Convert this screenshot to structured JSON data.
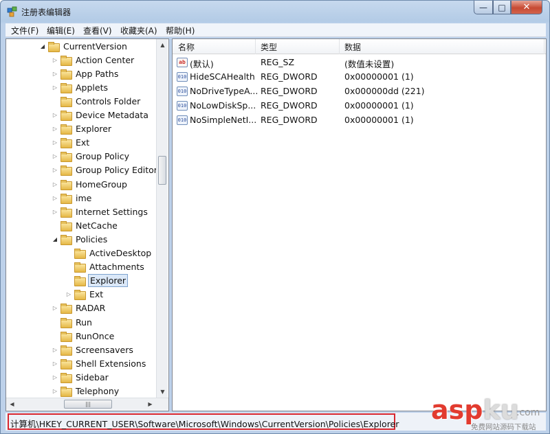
{
  "window": {
    "title": "注册表编辑器",
    "controls": {
      "minimize": "—",
      "maximize": "□",
      "close": "✕"
    }
  },
  "menubar": {
    "items": [
      {
        "label": "文件(F)"
      },
      {
        "label": "编辑(E)"
      },
      {
        "label": "查看(V)"
      },
      {
        "label": "收藏夹(A)"
      },
      {
        "label": "帮助(H)"
      }
    ]
  },
  "tree": {
    "items": [
      {
        "label": "CurrentVersion",
        "expander": "◢",
        "depth": 0
      },
      {
        "label": "Action Center",
        "expander": "▷",
        "depth": 1
      },
      {
        "label": "App Paths",
        "expander": "▷",
        "depth": 1
      },
      {
        "label": "Applets",
        "expander": "▷",
        "depth": 1
      },
      {
        "label": "Controls Folder",
        "expander": "",
        "depth": 1
      },
      {
        "label": "Device Metadata",
        "expander": "▷",
        "depth": 1
      },
      {
        "label": "Explorer",
        "expander": "▷",
        "depth": 1
      },
      {
        "label": "Ext",
        "expander": "▷",
        "depth": 1
      },
      {
        "label": "Group Policy",
        "expander": "▷",
        "depth": 1
      },
      {
        "label": "Group Policy Editor",
        "expander": "▷",
        "depth": 1
      },
      {
        "label": "HomeGroup",
        "expander": "▷",
        "depth": 1
      },
      {
        "label": "ime",
        "expander": "▷",
        "depth": 1
      },
      {
        "label": "Internet Settings",
        "expander": "▷",
        "depth": 1
      },
      {
        "label": "NetCache",
        "expander": "",
        "depth": 1
      },
      {
        "label": "Policies",
        "expander": "◢",
        "depth": 1
      },
      {
        "label": "ActiveDesktop",
        "expander": "",
        "depth": 2
      },
      {
        "label": "Attachments",
        "expander": "",
        "depth": 2
      },
      {
        "label": "Explorer",
        "expander": "",
        "depth": 2,
        "selected": true
      },
      {
        "label": "Ext",
        "expander": "▷",
        "depth": 2
      },
      {
        "label": "RADAR",
        "expander": "▷",
        "depth": 1
      },
      {
        "label": "Run",
        "expander": "",
        "depth": 1
      },
      {
        "label": "RunOnce",
        "expander": "",
        "depth": 1
      },
      {
        "label": "Screensavers",
        "expander": "▷",
        "depth": 1
      },
      {
        "label": "Shell Extensions",
        "expander": "▷",
        "depth": 1
      },
      {
        "label": "Sidebar",
        "expander": "▷",
        "depth": 1
      },
      {
        "label": "Telephony",
        "expander": "▷",
        "depth": 1
      }
    ],
    "scroll": {
      "up": "▲",
      "down": "▼",
      "left": "◀",
      "right": "▶",
      "grip": "|||"
    }
  },
  "values": {
    "columns": [
      "名称",
      "类型",
      "数据"
    ],
    "rows": [
      {
        "icon": "ab",
        "icon_kind": "string-value-icon",
        "name": "(默认)",
        "type": "REG_SZ",
        "data": "(数值未设置)"
      },
      {
        "icon": "010",
        "icon_kind": "dword-value-icon",
        "name": "HideSCAHealth",
        "type": "REG_DWORD",
        "data": "0x00000001 (1)"
      },
      {
        "icon": "010",
        "icon_kind": "dword-value-icon",
        "name": "NoDriveTypeA...",
        "type": "REG_DWORD",
        "data": "0x000000dd (221)"
      },
      {
        "icon": "010",
        "icon_kind": "dword-value-icon",
        "name": "NoLowDiskSp...",
        "type": "REG_DWORD",
        "data": "0x00000001 (1)"
      },
      {
        "icon": "010",
        "icon_kind": "dword-value-icon",
        "name": "NoSimpleNetI...",
        "type": "REG_DWORD",
        "data": "0x00000001 (1)"
      }
    ]
  },
  "statusbar": {
    "path": "计算机\\HKEY_CURRENT_USER\\Software\\Microsoft\\Windows\\CurrentVersion\\Policies\\Explorer",
    "highlight_color": "#d7262f"
  },
  "watermark": {
    "brand_a": "asp",
    "brand_b": "ku",
    "brand_c": ".com",
    "subtitle": "免费网站源码下载站"
  }
}
